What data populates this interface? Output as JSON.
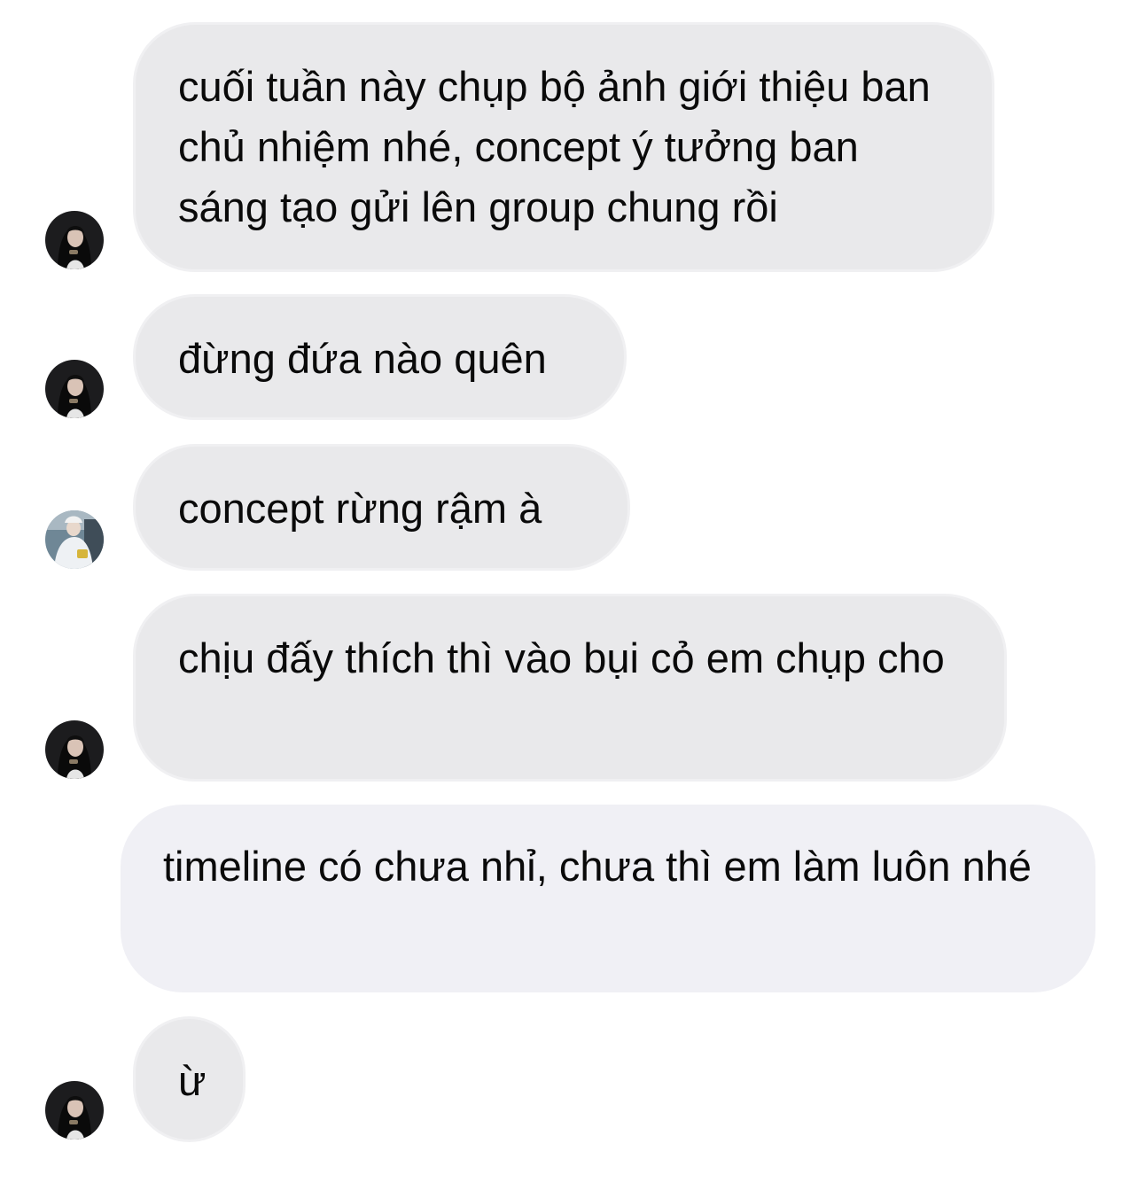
{
  "messages": [
    {
      "id": "m1",
      "sender": "avatar-a",
      "text": "cuối tuần này chụp bộ ảnh giới thiệu ban chủ nhiệm nhé, concept ý tưởng ban sáng tạo gửi lên group chung rồi"
    },
    {
      "id": "m2",
      "sender": "avatar-a",
      "text": "đừng đứa nào quên"
    },
    {
      "id": "m3",
      "sender": "avatar-b",
      "text": "concept rừng rậm à"
    },
    {
      "id": "m4",
      "sender": "avatar-a",
      "text": "chịu đấy thích thì vào bụi cỏ em chụp cho"
    },
    {
      "id": "m5",
      "sender": "",
      "text": "timeline có chưa nhỉ, chưa thì em làm luôn nhé"
    },
    {
      "id": "m6",
      "sender": "avatar-a",
      "text": "ừ"
    }
  ],
  "colors": {
    "bubble_gray": "#e9e9eb",
    "bubble_light": "#f0f0f5",
    "text": "#0a0a0a"
  }
}
